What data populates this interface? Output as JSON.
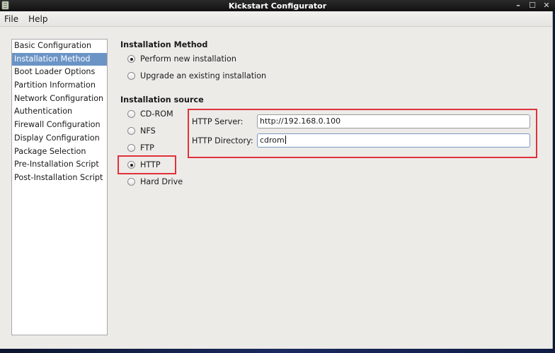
{
  "window": {
    "title": "Kickstart Configurator",
    "controls": {
      "minimize": "–",
      "maximize": "☐",
      "close": "✕"
    }
  },
  "menubar": {
    "items": [
      {
        "label": "File"
      },
      {
        "label": "Help"
      }
    ]
  },
  "sidebar": {
    "selected_index": 1,
    "items": [
      {
        "label": "Basic Configuration"
      },
      {
        "label": "Installation Method"
      },
      {
        "label": "Boot Loader Options"
      },
      {
        "label": "Partition Information"
      },
      {
        "label": "Network Configuration"
      },
      {
        "label": "Authentication"
      },
      {
        "label": "Firewall Configuration"
      },
      {
        "label": "Display Configuration"
      },
      {
        "label": "Package Selection"
      },
      {
        "label": "Pre-Installation Script"
      },
      {
        "label": "Post-Installation Script"
      }
    ]
  },
  "installation_method": {
    "title": "Installation Method",
    "options": [
      {
        "label": "Perform new installation",
        "checked": true
      },
      {
        "label": "Upgrade an existing installation",
        "checked": false
      }
    ]
  },
  "installation_source": {
    "title": "Installation source",
    "options": [
      {
        "label": "CD-ROM",
        "checked": false
      },
      {
        "label": "NFS",
        "checked": false
      },
      {
        "label": "FTP",
        "checked": false
      },
      {
        "label": "HTTP",
        "checked": true
      },
      {
        "label": "Hard Drive",
        "checked": false
      }
    ],
    "http": {
      "server_label": "HTTP Server:",
      "server_value": "http://192.168.0.100",
      "directory_label": "HTTP Directory:",
      "directory_value": "cdrom"
    }
  },
  "colors": {
    "highlight_box": "#e0323a",
    "selection": "#6b94c6"
  }
}
